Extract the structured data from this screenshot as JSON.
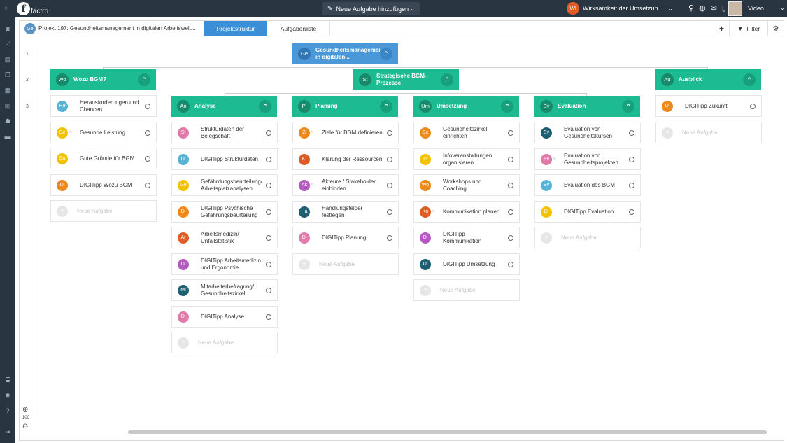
{
  "topbar": {
    "logo_text": "factro",
    "new_task_label": "Neue Aufgabe hinzufügen",
    "user_badge": "Wi",
    "user_label": "Wirksamkeit der Umsetzun...",
    "video_label": "Video"
  },
  "header": {
    "project_badge": "Ge",
    "project_title": "Projekt 197: Gesundheitsmanagement in digitalen Arbeitswelt...",
    "tab_struktur": "Projektstruktur",
    "tab_liste": "Aufgabenliste",
    "filter_label": "Filter"
  },
  "levels": [
    "1",
    "2",
    "3"
  ],
  "zoom_value": "100",
  "root": {
    "badge": "Ge",
    "title": "Gesundheitsmanagement in digitalen..."
  },
  "level2": [
    {
      "badge": "Wo",
      "title": "Wozu BGM?",
      "color": "#1dbb91"
    },
    {
      "badge": "St",
      "title": "Strategische BGM-Prozesse",
      "color": "#1dbb91"
    },
    {
      "badge": "Au",
      "title": "Ausblick",
      "color": "#1dbb91"
    }
  ],
  "level3": [
    {
      "badge": "An",
      "title": "Analyse"
    },
    {
      "badge": "Pl",
      "title": "Planung"
    },
    {
      "badge": "Um",
      "title": "Umsetzung"
    },
    {
      "badge": "Ev",
      "title": "Evaluation"
    }
  ],
  "add_label": "Neue Aufgabe",
  "columns": {
    "wozu": [
      {
        "badge": "He",
        "color": "#5ab3d6",
        "title": "Herausforderungen und Chancen",
        "pencil": false
      },
      {
        "badge": "Ge",
        "color": "#f2c200",
        "title": "Gesunde Leistung",
        "pencil": true
      },
      {
        "badge": "Gu",
        "color": "#f2c200",
        "title": "Gute Gründe für BGM",
        "pencil": false
      },
      {
        "badge": "Di",
        "color": "#ef8a1a",
        "title": "DIGITipp Wozu BGM",
        "pencil": false
      }
    ],
    "analyse": [
      {
        "badge": "St",
        "color": "#e07aa8",
        "title": "Strukturdaten der Belegschaft",
        "pencil": false
      },
      {
        "badge": "Di",
        "color": "#5ab3d6",
        "title": "DIGITipp Strukturdaten",
        "pencil": false
      },
      {
        "badge": "Ge",
        "color": "#f2c200",
        "title": "Gefährdungsbeurteilung/ Arbeitsplatzanalysen",
        "pencil": false
      },
      {
        "badge": "Di",
        "color": "#ef8a1a",
        "title": "DIGITipp Psychische Gefährungsbeurteilung",
        "pencil": false
      },
      {
        "badge": "Ar",
        "color": "#e05c25",
        "title": "Arbeitsmedizin/ Unfallstatistik",
        "pencil": false
      },
      {
        "badge": "Di",
        "color": "#b35bbf",
        "title": "DIGITipp Arbeitsmedizin und Ergonomie",
        "pencil": false
      },
      {
        "badge": "Mi",
        "color": "#1e5f73",
        "title": "Mitarbeiterbefragung/ Gesundheitszirkel",
        "pencil": false
      },
      {
        "badge": "Di",
        "color": "#e07aa8",
        "title": "DIGITipp Analyse",
        "pencil": false
      }
    ],
    "planung": [
      {
        "badge": "Zi",
        "color": "#ef8a1a",
        "title": "Ziele für BGM definieren",
        "pencil": true
      },
      {
        "badge": "Kl",
        "color": "#e05c25",
        "title": "Klärung der Ressourcen",
        "pencil": false
      },
      {
        "badge": "Ak",
        "color": "#b35bbf",
        "title": "Akteure / Stakeholder einbinden",
        "pencil": true
      },
      {
        "badge": "Ha",
        "color": "#1e5f73",
        "title": "Handlungsfelder festlegen",
        "pencil": false
      },
      {
        "badge": "Di",
        "color": "#e07aa8",
        "title": "DIGITipp Planung",
        "pencil": false
      }
    ],
    "umsetzung": [
      {
        "badge": "Ge",
        "color": "#ef8a1a",
        "title": "Gesundheitszirkel einrichten",
        "pencil": false
      },
      {
        "badge": "In",
        "color": "#f2c200",
        "title": "Infoveranstaltungen organisieren",
        "pencil": false
      },
      {
        "badge": "Wo",
        "color": "#ef8a1a",
        "title": "Workshops und Coaching",
        "pencil": false
      },
      {
        "badge": "Ko",
        "color": "#e05c25",
        "title": "Kommunikation planen",
        "pencil": true
      },
      {
        "badge": "Di",
        "color": "#b35bbf",
        "title": "DIGITipp Kommunikation",
        "pencil": false
      },
      {
        "badge": "Di",
        "color": "#1e5f73",
        "title": "DIGITipp Umsetzung",
        "pencil": false
      }
    ],
    "evaluation": [
      {
        "badge": "Ev",
        "color": "#1e5f73",
        "title": "Evaluation von Gesundheitskursen",
        "pencil": false
      },
      {
        "badge": "Ev",
        "color": "#e07aa8",
        "title": "Evaluation von Gesundheitsprojekten",
        "pencil": true
      },
      {
        "badge": "Ev",
        "color": "#5ab3d6",
        "title": "Evaluation des BGM",
        "pencil": false
      },
      {
        "badge": "Di",
        "color": "#f2c200",
        "title": "DIGITipp Evaluation",
        "pencil": false
      }
    ],
    "ausblick": [
      {
        "badge": "Di",
        "color": "#ef8a1a",
        "title": "DIGITipp Zukunft",
        "pencil": false
      }
    ]
  }
}
